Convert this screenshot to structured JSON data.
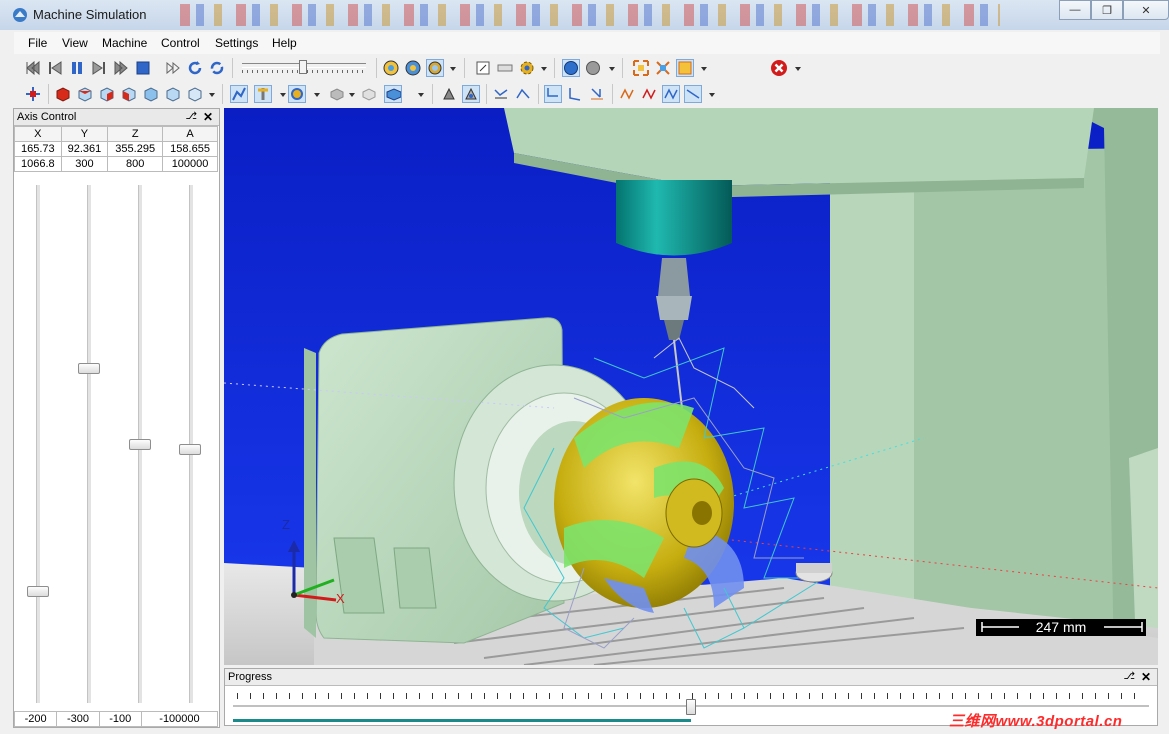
{
  "window": {
    "title": "Machine Simulation"
  },
  "menu": {
    "file": "File",
    "view": "View",
    "machine": "Machine",
    "control": "Control",
    "settings": "Settings",
    "help": "Help"
  },
  "axis_panel": {
    "title": "Axis Control",
    "columns": [
      "X",
      "Y",
      "Z",
      "A"
    ],
    "positions": [
      "165.73",
      "92.361",
      "355.295",
      "158.655"
    ],
    "upper_limits": [
      "1066.8",
      "300",
      "800",
      "100000"
    ],
    "lower_limits": [
      "-200",
      "-300",
      "-100",
      "-100000"
    ],
    "slider_levels": [
      0.21,
      0.65,
      0.5,
      0.49
    ]
  },
  "viewport": {
    "scale_label": "247 mm",
    "triad": {
      "z": "Z",
      "x": "X"
    }
  },
  "progress": {
    "title": "Progress",
    "level": 0.5
  },
  "watermark": "三维网www.3dportal.cn",
  "colors": {
    "background": "#0b1fd0",
    "machine": "#b4d6b6",
    "part": "#c8b400"
  }
}
